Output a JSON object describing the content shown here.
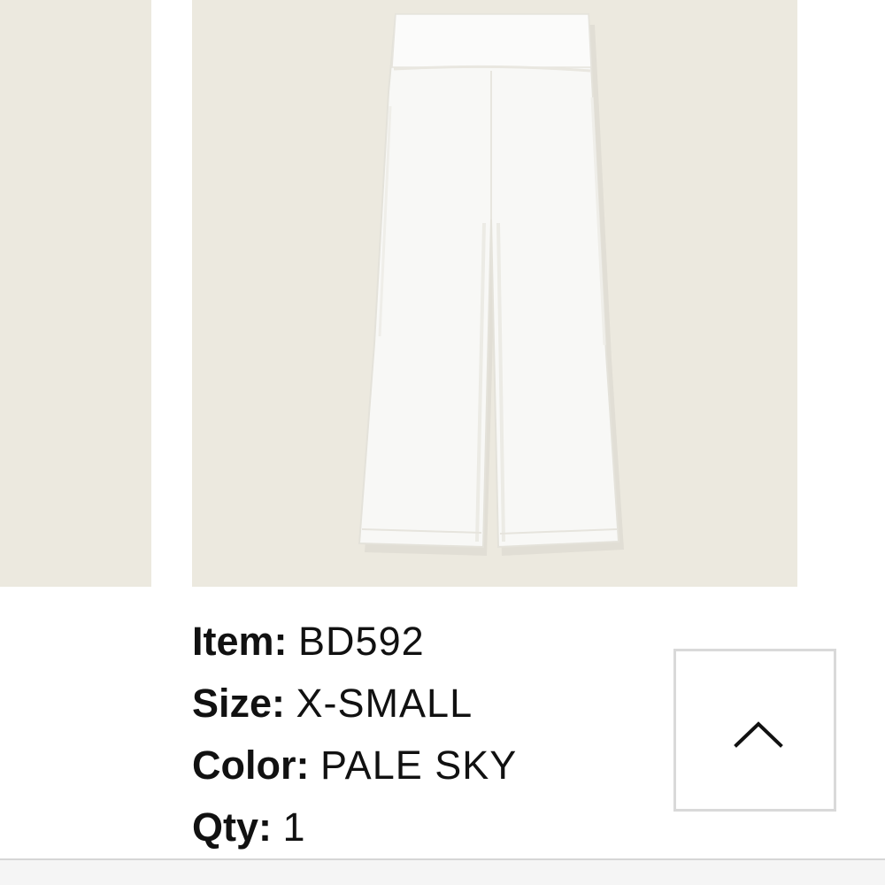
{
  "gallery": {
    "background_color": "#ece9df",
    "product_color": "#ffffff",
    "product_image": "wide-leg pants"
  },
  "details": {
    "item_label": "Item:",
    "item_value": "BD592",
    "size_label": "Size:",
    "size_value": "X-SMALL",
    "color_label": "Color:",
    "color_value": "PALE SKY",
    "qty_label": "Qty:",
    "qty_value": "1"
  },
  "scroll_top": {
    "icon": "chevron-up-icon"
  }
}
